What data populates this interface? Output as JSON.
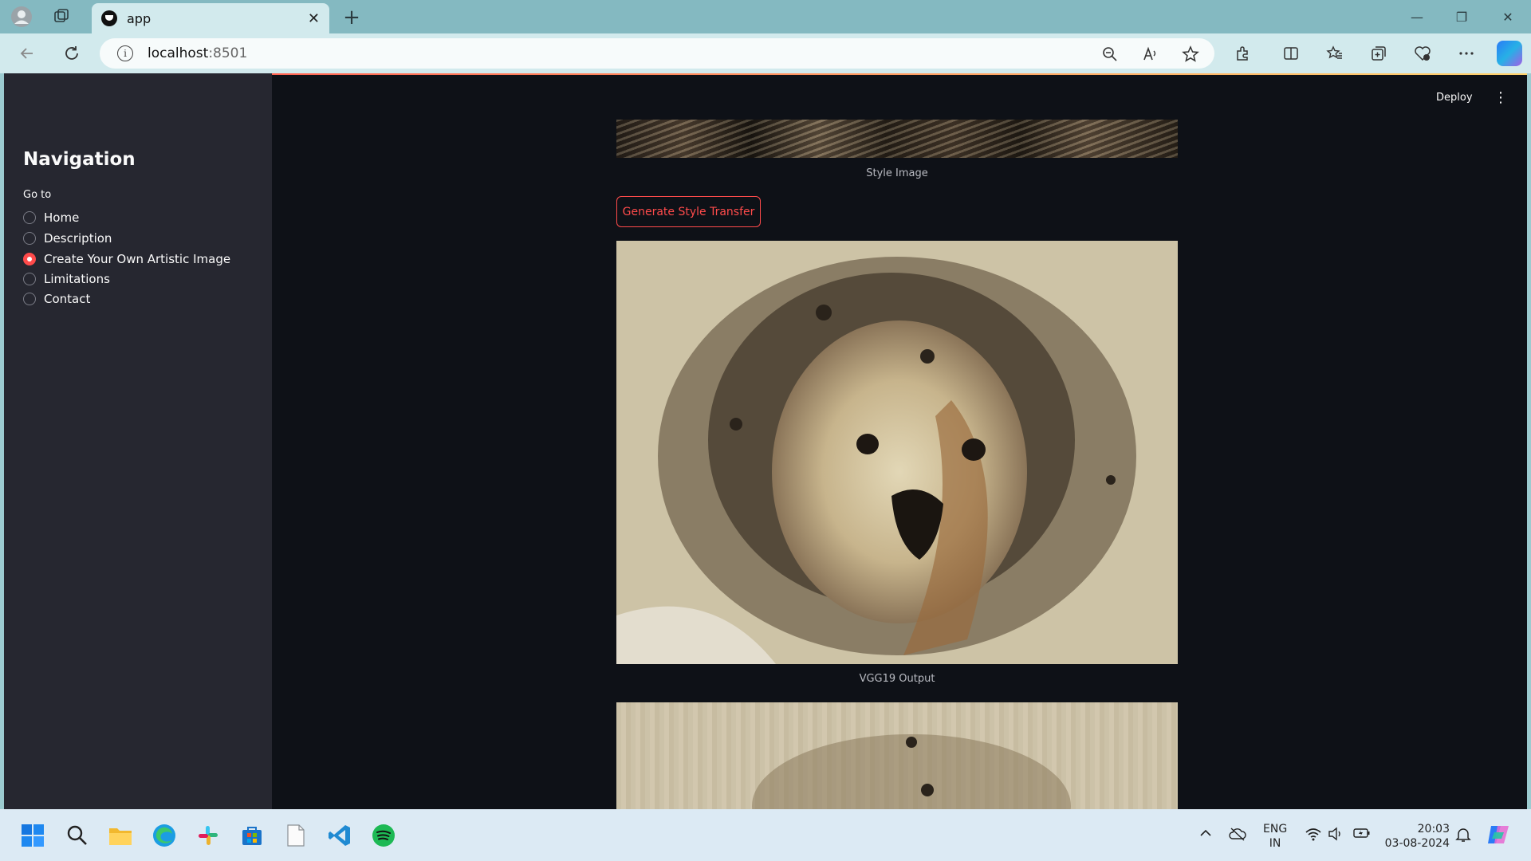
{
  "browser": {
    "tab_title": "app",
    "tab_close": "✕",
    "new_tab": "+",
    "url_host": "localhost",
    "url_port": ":8501",
    "info_icon": "i",
    "window_controls": [
      "—",
      "❐",
      "✕"
    ]
  },
  "sidebar": {
    "title": "Navigation",
    "radio_label": "Go to",
    "options": [
      {
        "label": "Home",
        "selected": false
      },
      {
        "label": "Description",
        "selected": false
      },
      {
        "label": "Create Your Own Artistic Image",
        "selected": true
      },
      {
        "label": "Limitations",
        "selected": false
      },
      {
        "label": "Contact",
        "selected": false
      }
    ]
  },
  "header": {
    "deploy_label": "Deploy",
    "menu_icon": "⋮"
  },
  "main": {
    "style_caption": "Style Image",
    "generate_button": "Generate Style Transfer",
    "vgg19_caption": "VGG19 Output"
  },
  "taskbar": {
    "lang_line1": "ENG",
    "lang_line2": "IN",
    "time": "20:03",
    "date": "03-08-2024"
  },
  "colors": {
    "accent": "#ff4b4b",
    "app_bg": "#0e1117",
    "sidebar_bg": "#262730"
  }
}
